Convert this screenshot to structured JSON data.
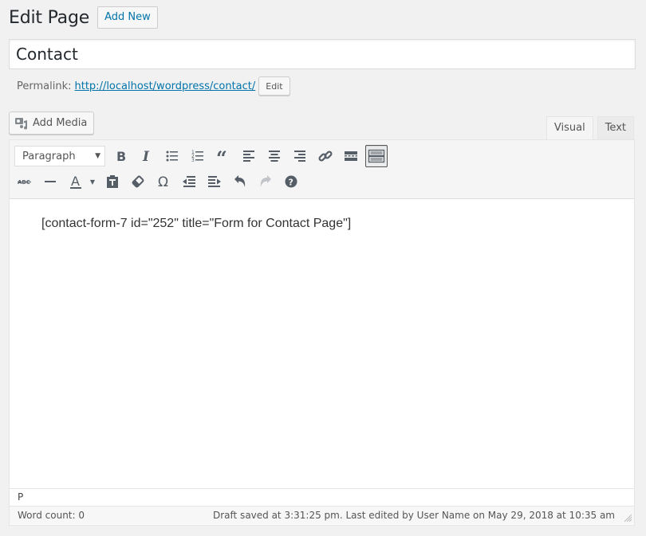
{
  "header": {
    "title": "Edit Page",
    "add_new_label": "Add New"
  },
  "post": {
    "title": "Contact",
    "permalink_label": "Permalink:",
    "permalink_url": "http://localhost/wordpress/contact/",
    "permalink_edit_label": "Edit"
  },
  "editor": {
    "add_media_label": "Add Media",
    "tabs": [
      {
        "label": "Visual",
        "active": true
      },
      {
        "label": "Text",
        "active": false
      }
    ],
    "format_select": {
      "selected": "Paragraph"
    },
    "toolbar_row1": [
      "bold",
      "italic",
      "bulleted-list",
      "numbered-list",
      "blockquote",
      "align-left",
      "align-center",
      "align-right",
      "insert-link",
      "read-more",
      "toolbar-toggle"
    ],
    "toolbar_row2": [
      "strikethrough",
      "horizontal-line",
      "text-color",
      "paste-as-text",
      "clear-formatting",
      "special-character",
      "decrease-indent",
      "increase-indent",
      "undo",
      "redo",
      "keyboard-shortcuts"
    ],
    "content": "[contact-form-7 id=\"252\" title=\"Form for Contact Page\"]",
    "path": "P",
    "word_count": "Word count: 0",
    "draft_status": "Draft saved at 3:31:25 pm. Last edited by User Name on May 29, 2018 at 10:35 am"
  },
  "colors": {
    "link": "#0073aa",
    "icon": "#555d66",
    "background": "#f1f1f1"
  }
}
